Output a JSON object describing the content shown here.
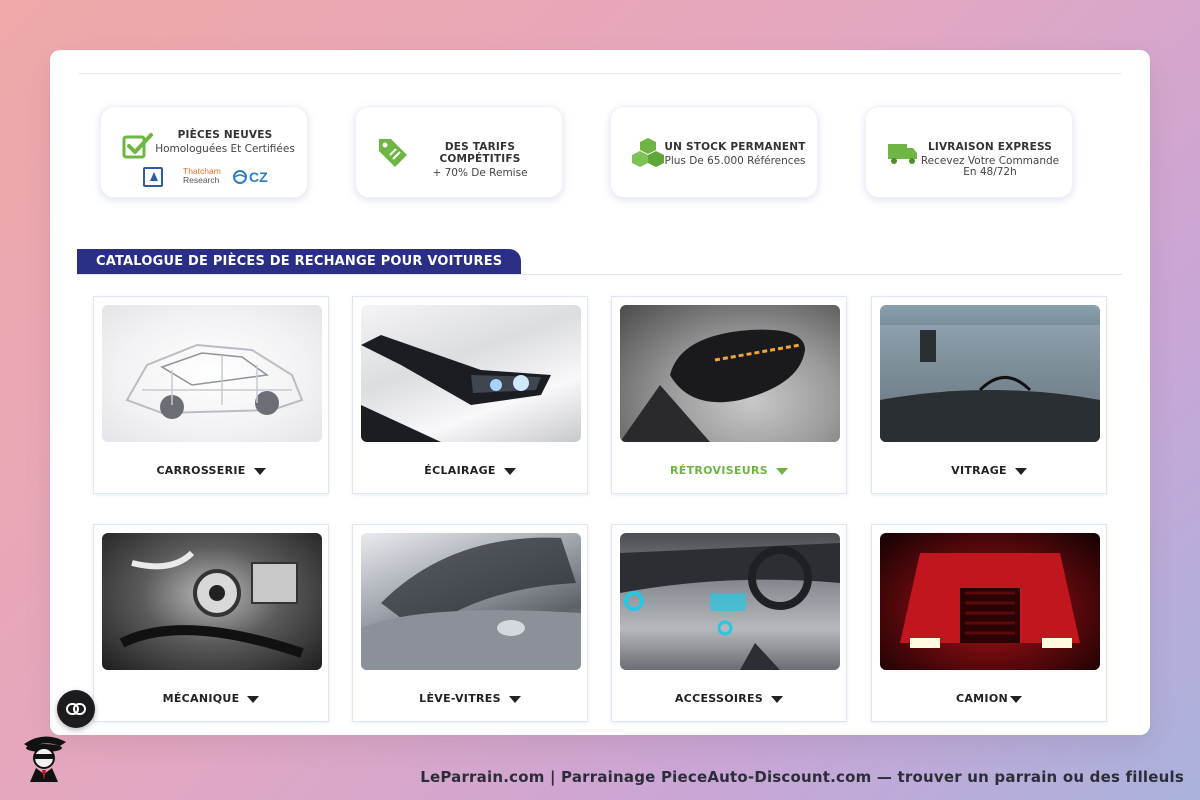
{
  "features": [
    {
      "title": "PIÈCES NEUVES",
      "subtitle": "Homologuées Et Certifiées",
      "icon": "checkbox-check-icon"
    },
    {
      "title": "DES TARIFS COMPÉTITIFS",
      "subtitle": "+ 70% De Remise",
      "icon": "price-tag-icon"
    },
    {
      "title": "UN STOCK PERMANENT",
      "subtitle": "Plus De 65.000 Références",
      "icon": "stacked-boxes-icon"
    },
    {
      "title": "LIVRAISON EXPRESS",
      "subtitle": "Recevez Votre Commande En 48/72h",
      "icon": "delivery-truck-icon"
    }
  ],
  "certifications": {
    "thatcham_line1": "Thatcham",
    "thatcham_line2": "Research",
    "cz_label": "CZ"
  },
  "catalog": {
    "heading": "CATALOGUE DE PIÈCES DE RECHANGE POUR VOITURES",
    "categories": [
      {
        "label": "CARROSSERIE",
        "active": false
      },
      {
        "label": "ÉCLAIRAGE",
        "active": false
      },
      {
        "label": "RÉTROVISEURS",
        "active": true
      },
      {
        "label": "VITRAGE",
        "active": false
      },
      {
        "label": "MÉCANIQUE",
        "active": false
      },
      {
        "label": "LÈVE-VITRES",
        "active": false
      },
      {
        "label": "ACCESSOIRES",
        "active": false
      },
      {
        "label": "CAMION",
        "active": false
      }
    ]
  },
  "footer": {
    "text": "LeParrain.com | Parrainage PieceAuto-Discount.com — trouver un parrain ou des filleuls"
  },
  "colors": {
    "accent_green": "#6fb543",
    "tab_navy": "#2a2e85"
  }
}
